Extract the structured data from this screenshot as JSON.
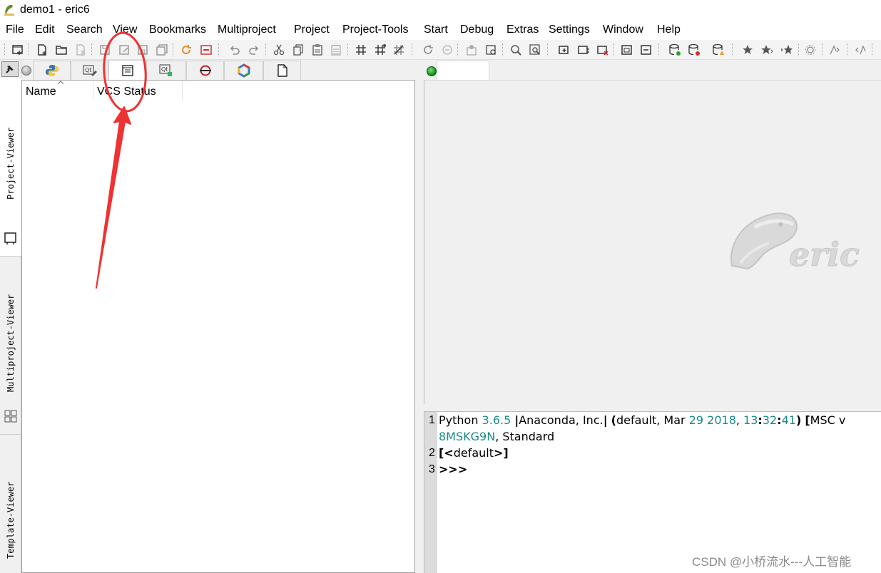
{
  "window": {
    "title": "demo1 - eric6",
    "app_icon": "eric-snake-icon"
  },
  "menubar": {
    "items": [
      "File",
      "Edit",
      "Search",
      "View",
      "Bookmarks",
      "Multiproject",
      "Project",
      "Project-Tools",
      "Start",
      "Debug",
      "Extras",
      "Settings",
      "Window",
      "Help"
    ]
  },
  "toolbar": {
    "icons": [
      "toolbar-new-window-icon",
      "new-file-icon",
      "open-folder-icon",
      "close-file-icon",
      "save-icon",
      "save-as-icon",
      "save-copy-icon",
      "save-all-icon",
      "reload-icon",
      "close-all-icon",
      "undo-icon",
      "redo-icon",
      "cut-icon",
      "copy-icon",
      "paste-icon",
      "clear-icon",
      "hash-icon",
      "hash-alt-icon",
      "hash-remove-icon",
      "refresh-icon",
      "minus-circle-icon",
      "project-settings-icon",
      "project-properties-icon",
      "search-project-icon",
      "search-replace-icon",
      "add-files-icon",
      "add-directory-icon",
      "remove-files-icon",
      "export-icon",
      "import-icon",
      "database-add-icon",
      "database-remove-icon",
      "database-warning-icon",
      "bookmark-toggle-icon",
      "bookmark-next-icon",
      "bookmark-prev-icon",
      "gear-icon",
      "indent-icon",
      "unindent-icon"
    ]
  },
  "sidebar": {
    "tabs": [
      {
        "label": "Project-Viewer",
        "icon": "project-viewer-icon"
      },
      {
        "label": "Multiproject-Viewer",
        "icon": "multiproject-viewer-icon"
      },
      {
        "label": "Template-Viewer",
        "icon": "template-viewer-icon"
      }
    ]
  },
  "project_viewer": {
    "tab_icons": [
      "python-sources-icon",
      "qt-forms-icon",
      "others-icon",
      "qt-resources-icon",
      "translations-icon",
      "interfaces-icon",
      "other-files-icon"
    ],
    "active_tab_index": 2,
    "columns": [
      "Name",
      "VCS Status"
    ]
  },
  "editor": {
    "logo_text": "eric"
  },
  "shell": {
    "line_numbers": [
      "1",
      "2",
      "3"
    ],
    "line1": {
      "p1": "Python ",
      "ver": "3.6.5",
      "p2": " ",
      "bar1": "|",
      "p3": "Anaconda, Inc.",
      "bar2": "|",
      "p4": " ",
      "paren_open": "(",
      "p5": "default, Mar ",
      "day": "29",
      "p6": " ",
      "year": "2018",
      "p7": ", ",
      "hh": "13",
      "colon1": ":",
      "mm": "32",
      "colon2": ":",
      "ss": "41",
      "paren_close": ")",
      "p8": " ",
      "bracket": "[",
      "p9": "MSC v"
    },
    "line1_wrap": {
      "host": "8MSKG9N",
      "rest": ", Standard"
    },
    "line2": {
      "open": "[<",
      "text": "default",
      "close": ">]"
    },
    "line3": ">>>"
  },
  "annotation": {
    "color": "#ee3333"
  },
  "watermark": "CSDN @小桥流水---人工智能"
}
